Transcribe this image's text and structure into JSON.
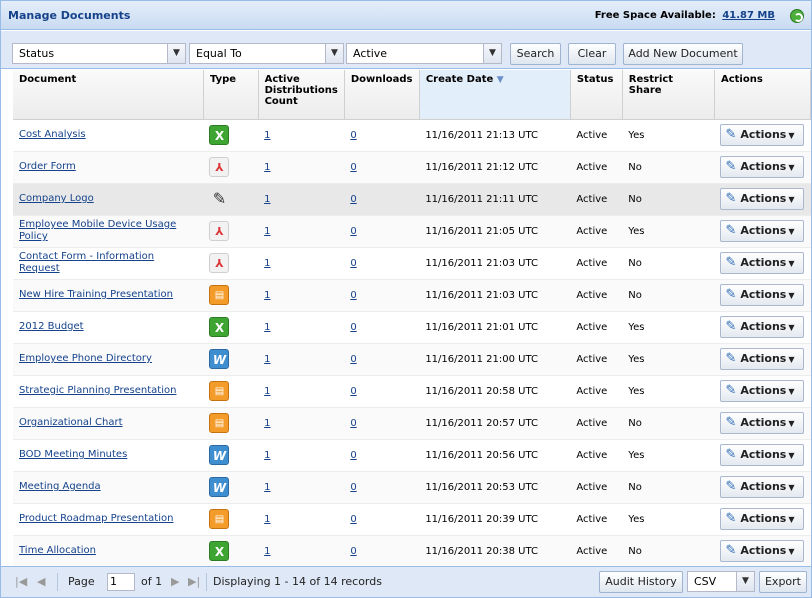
{
  "header": {
    "title": "Manage Documents",
    "free_space_label": "Free Space Available:",
    "free_space_value": "41.87 MB"
  },
  "filter": {
    "field": "Status",
    "operator": "Equal To",
    "value": "Active",
    "search_label": "Search",
    "clear_label": "Clear",
    "add_label": "Add New Document"
  },
  "columns": {
    "document": "Document",
    "type": "Type",
    "active": "Active Distributions Count",
    "downloads": "Downloads",
    "create_date": "Create Date",
    "status": "Status",
    "restrict": "Restrict Share",
    "actions": "Actions"
  },
  "rows": [
    {
      "name": "Cost Analysis",
      "type": "excel-icon",
      "active": "1",
      "downloads": "0",
      "date": "11/16/2011 21:13 UTC",
      "status": "Active",
      "restrict": "Yes",
      "action": "Actions"
    },
    {
      "name": "Order Form",
      "type": "pdf-icon",
      "active": "1",
      "downloads": "0",
      "date": "11/16/2011 21:12 UTC",
      "status": "Active",
      "restrict": "No",
      "action": "Actions"
    },
    {
      "name": "Company Logo",
      "type": "image-icon",
      "active": "1",
      "downloads": "0",
      "date": "11/16/2011 21:11 UTC",
      "status": "Active",
      "restrict": "No",
      "action": "Actions"
    },
    {
      "name": "Employee Mobile Device Usage Policy",
      "type": "pdf-icon",
      "active": "1",
      "downloads": "0",
      "date": "11/16/2011 21:05 UTC",
      "status": "Active",
      "restrict": "Yes",
      "action": "Actions"
    },
    {
      "name": "Contact Form - Information Request",
      "type": "pdf-icon",
      "active": "1",
      "downloads": "0",
      "date": "11/16/2011 21:03 UTC",
      "status": "Active",
      "restrict": "No",
      "action": "Actions"
    },
    {
      "name": "New Hire Training Presentation",
      "type": "powerpoint-icon",
      "active": "1",
      "downloads": "0",
      "date": "11/16/2011 21:03 UTC",
      "status": "Active",
      "restrict": "No",
      "action": "Actions"
    },
    {
      "name": "2012 Budget",
      "type": "excel-icon",
      "active": "1",
      "downloads": "0",
      "date": "11/16/2011 21:01 UTC",
      "status": "Active",
      "restrict": "Yes",
      "action": "Actions"
    },
    {
      "name": "Employee Phone Directory",
      "type": "word-icon",
      "active": "1",
      "downloads": "0",
      "date": "11/16/2011 21:00 UTC",
      "status": "Active",
      "restrict": "Yes",
      "action": "Actions"
    },
    {
      "name": "Strategic Planning Presentation",
      "type": "powerpoint-icon",
      "active": "1",
      "downloads": "0",
      "date": "11/16/2011 20:58 UTC",
      "status": "Active",
      "restrict": "Yes",
      "action": "Actions"
    },
    {
      "name": "Organizational Chart",
      "type": "powerpoint-icon",
      "active": "1",
      "downloads": "0",
      "date": "11/16/2011 20:57 UTC",
      "status": "Active",
      "restrict": "No",
      "action": "Actions"
    },
    {
      "name": "BOD Meeting Minutes",
      "type": "word-icon",
      "active": "1",
      "downloads": "0",
      "date": "11/16/2011 20:56 UTC",
      "status": "Active",
      "restrict": "Yes",
      "action": "Actions"
    },
    {
      "name": "Meeting Agenda",
      "type": "word-icon",
      "active": "1",
      "downloads": "0",
      "date": "11/16/2011 20:53 UTC",
      "status": "Active",
      "restrict": "No",
      "action": "Actions"
    },
    {
      "name": "Product Roadmap Presentation",
      "type": "powerpoint-icon",
      "active": "1",
      "downloads": "0",
      "date": "11/16/2011 20:39 UTC",
      "status": "Active",
      "restrict": "Yes",
      "action": "Actions"
    },
    {
      "name": "Time Allocation",
      "type": "excel-icon",
      "active": "1",
      "downloads": "0",
      "date": "11/16/2011 20:38 UTC",
      "status": "Active",
      "restrict": "No",
      "action": "Actions"
    }
  ],
  "pager": {
    "page_label": "Page",
    "page_value": "1",
    "of_label": "of 1",
    "display_text": "Displaying 1 - 14 of 14 records",
    "audit_label": "Audit History",
    "format_value": "CSV",
    "export_label": "Export"
  },
  "colors": {
    "accent": "#15428b",
    "header_bg": "#dfe8f6",
    "border": "#99bbe8"
  }
}
